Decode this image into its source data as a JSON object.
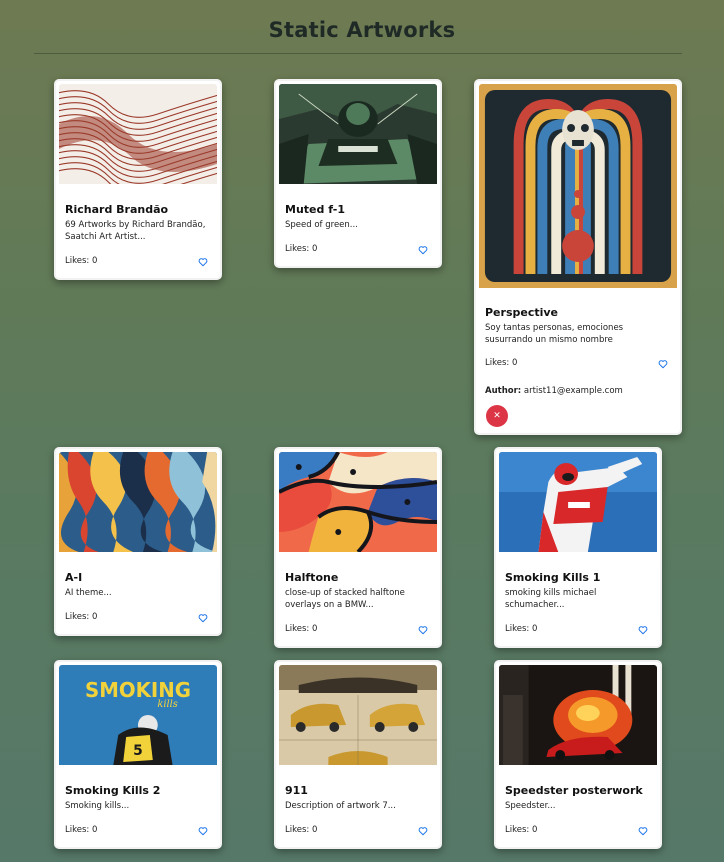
{
  "page": {
    "title": "Static Artworks"
  },
  "colors": {
    "heart": "#1a73e8",
    "delete": "#dc3545"
  },
  "cards": [
    {
      "title": "Richard Brandão",
      "description": "69 Artworks by Richard Brandão, Saatchi Art Artist...",
      "likes": "Likes: 0"
    },
    {
      "title": "Muted f-1",
      "description": "Speed of green...",
      "likes": "Likes: 0"
    },
    {
      "title": "Perspective",
      "description": "Soy tantas personas, emociones susurrando un mismo nombre",
      "likes": "Likes: 0",
      "author_label": "Author:",
      "author": "artist11@example.com",
      "delete_icon": "close-icon"
    },
    {
      "title": "A-I",
      "description": "AI theme...",
      "likes": "Likes: 0"
    },
    {
      "title": "Halftone",
      "description": "close-up of stacked halftone overlays on a BMW...",
      "likes": "Likes: 0"
    },
    {
      "title": "Smoking Kills 1",
      "description": "smoking kills michael schumacher...",
      "likes": "Likes: 0"
    },
    {
      "title": "Smoking Kills 2",
      "description": "Smoking kills...",
      "likes": "Likes: 0",
      "image_text": "SMOKING",
      "image_subtext": "kills"
    },
    {
      "title": "911",
      "description": "Description of artwork 7...",
      "likes": "Likes: 0"
    },
    {
      "title": "Speedster posterwork",
      "description": "Speedster...",
      "likes": "Likes: 0"
    }
  ]
}
